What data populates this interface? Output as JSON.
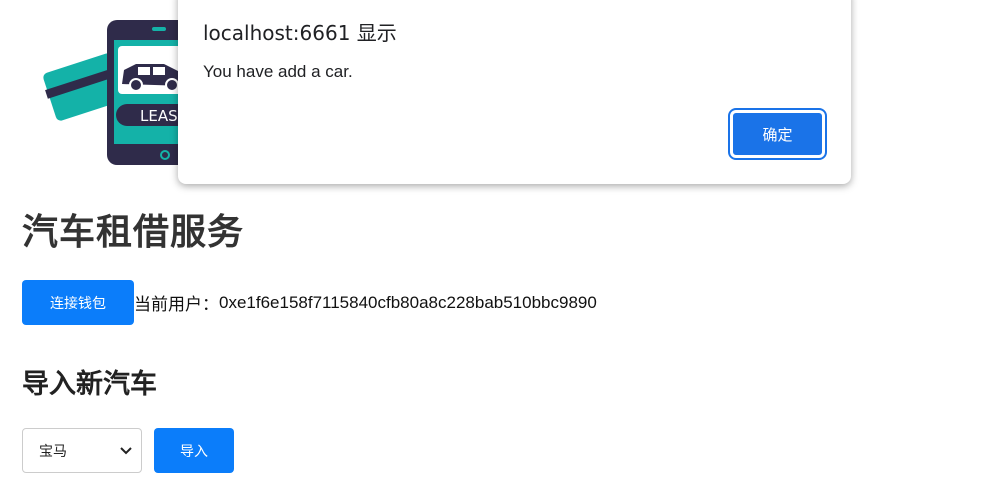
{
  "page": {
    "title": "汽车租借服务",
    "logo_text": "LEASE"
  },
  "wallet": {
    "connect_label": "连接钱包",
    "current_user_label": "当前用户：",
    "address": "0xe1f6e158f7115840cfb80a8c228bab510bbc9890"
  },
  "import_section": {
    "title": "导入新汽车",
    "selected_car": "宝马",
    "import_label": "导入"
  },
  "dialog": {
    "origin": "localhost:6661 显示",
    "message": "You have add a car.",
    "ok_label": "确定"
  },
  "colors": {
    "primary_button": "#0b7dfa",
    "dialog_button": "#1a73e8",
    "logo_teal": "#14b2a8",
    "logo_dark": "#2f2b4a"
  }
}
